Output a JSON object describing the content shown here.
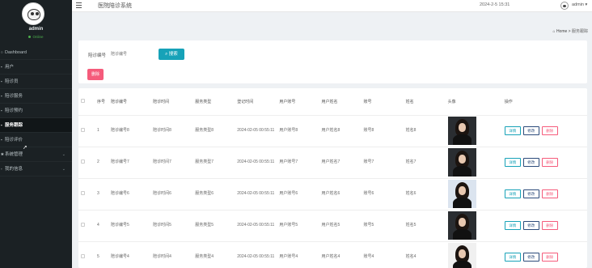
{
  "user": {
    "name": "admin",
    "status": "Online"
  },
  "sidebar": {
    "items": [
      {
        "label": "Dashboard",
        "icon": "circle-icon"
      },
      {
        "label": "用户",
        "icon": "user-icon"
      },
      {
        "label": "陪诊员",
        "icon": "user-icon"
      },
      {
        "label": "陪诊服务",
        "icon": "list-icon"
      },
      {
        "label": "陪诊预约",
        "icon": "list-icon"
      },
      {
        "label": "服务跟踪",
        "icon": "list-icon"
      },
      {
        "label": "陪诊评价",
        "icon": "list-icon"
      },
      {
        "label": "系统管理",
        "icon": "gear-icon"
      },
      {
        "label": "我的信息",
        "icon": "user-icon"
      }
    ],
    "active": "服务跟踪"
  },
  "topbar": {
    "title": "医院陪诊系统",
    "datetime": "2024-2-5 15:31",
    "user": "admin"
  },
  "breadcrumb": {
    "home": "Home",
    "separator": ">",
    "current": "服务跟踪"
  },
  "search": {
    "label": "陪诊编号",
    "placeholder": "陪诊编号",
    "button": "搜索"
  },
  "actions": {
    "delete": "删除"
  },
  "table": {
    "headers": [
      "序号",
      "陪诊编号",
      "陪诊时间",
      "服务类型",
      "登记时间",
      "用户账号",
      "用户姓名",
      "账号",
      "姓名",
      "头像",
      "操作"
    ],
    "ops": {
      "detail": "详情",
      "edit": "修改",
      "delete": "删除"
    },
    "rows": [
      {
        "no": "1",
        "code": "陪诊编号8",
        "time": "陪诊时间8",
        "type": "服务类型8",
        "reg": "2024-02-05 00:55:11",
        "account": "用户账号8",
        "uname": "用户姓名8",
        "acc": "账号8",
        "name": "姓名8",
        "photo": "dark"
      },
      {
        "no": "2",
        "code": "陪诊编号7",
        "time": "陪诊时间7",
        "type": "服务类型7",
        "reg": "2024-02-05 00:55:11",
        "account": "用户账号7",
        "uname": "用户姓名7",
        "acc": "账号7",
        "name": "姓名7",
        "photo": "dark"
      },
      {
        "no": "3",
        "code": "陪诊编号6",
        "time": "陪诊时间6",
        "type": "服务类型6",
        "reg": "2024-02-05 00:55:11",
        "account": "用户账号6",
        "uname": "用户姓名6",
        "acc": "账号6",
        "name": "姓名6",
        "photo": "blue"
      },
      {
        "no": "4",
        "code": "陪诊编号5",
        "time": "陪诊时间5",
        "type": "服务类型5",
        "reg": "2024-02-05 00:55:11",
        "account": "用户账号5",
        "uname": "用户姓名5",
        "acc": "账号5",
        "name": "姓名5",
        "photo": "dark"
      },
      {
        "no": "5",
        "code": "陪诊编号4",
        "time": "陪诊时间4",
        "type": "服务类型4",
        "reg": "2024-02-05 00:55:11",
        "account": "用户账号4",
        "uname": "用户姓名4",
        "acc": "账号4",
        "name": "姓名4",
        "photo": "light"
      }
    ]
  },
  "colors": {
    "sidebar": "#1b2124",
    "primary": "#17a2b8",
    "danger": "#f55b7b",
    "edit": "#2b4a7a"
  }
}
